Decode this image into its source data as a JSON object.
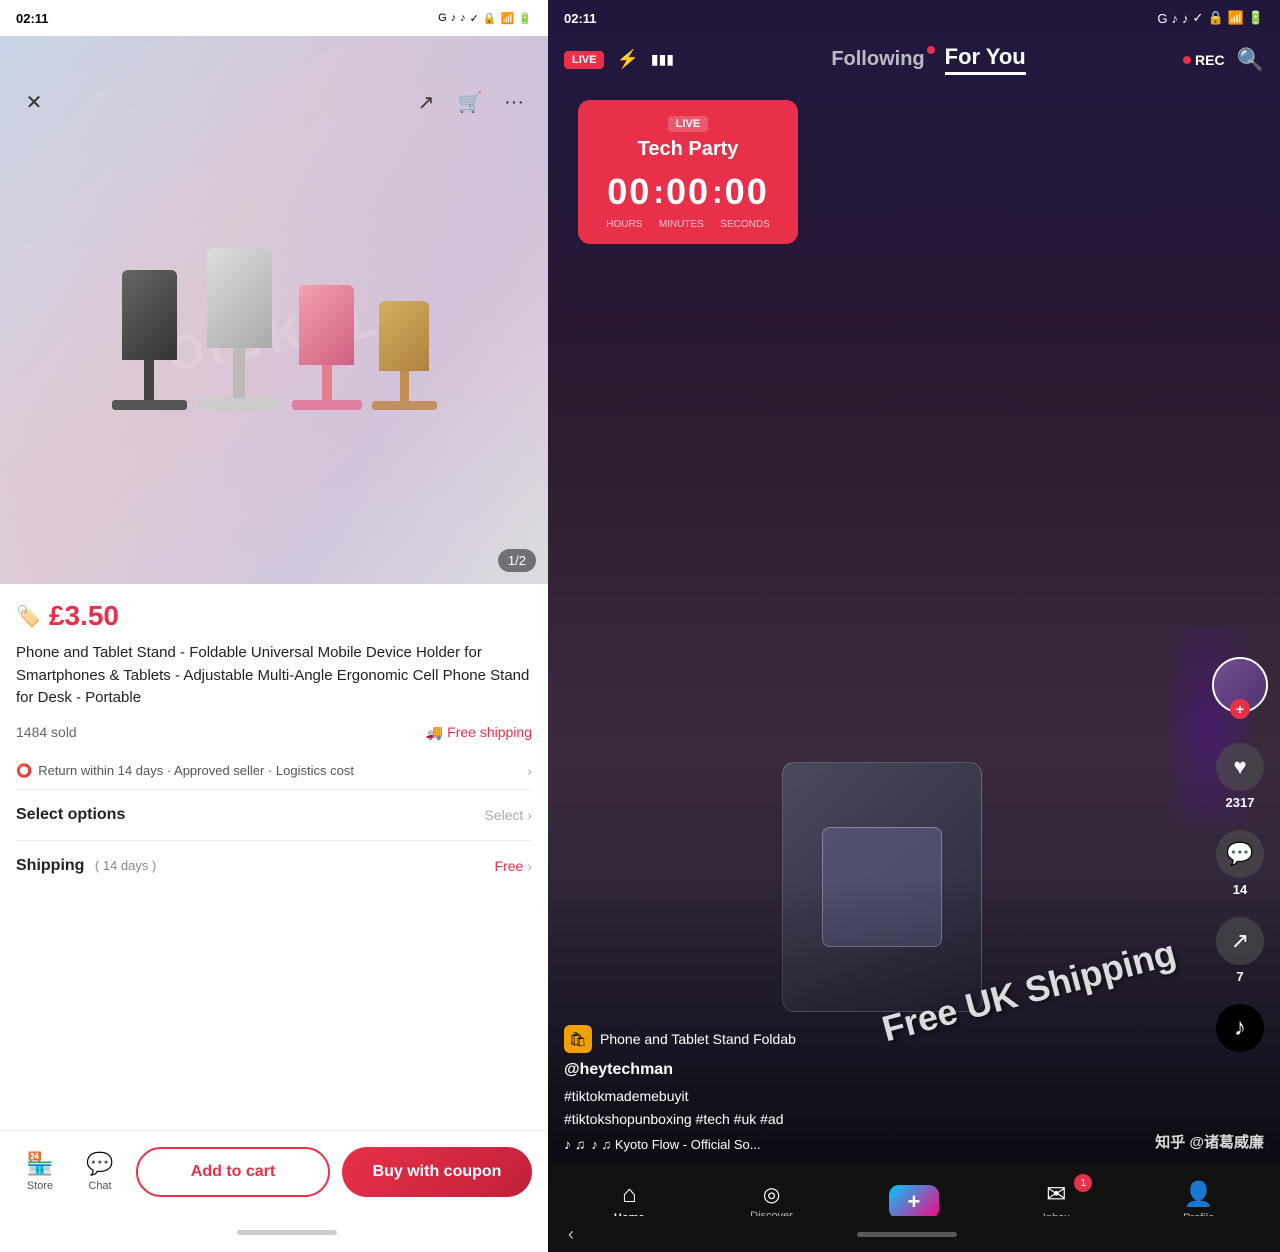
{
  "left": {
    "statusBar": {
      "time": "02:11",
      "icons": [
        "G",
        "TikTok",
        "TikTok",
        "✓",
        "•"
      ]
    },
    "topNav": {
      "close": "✕",
      "share": "↗",
      "cart": "🛒",
      "more": "···"
    },
    "product": {
      "price": "£3.50",
      "priceIcon": "🏷",
      "title": "Phone and Tablet Stand - Foldable Universal Mobile Device Holder for Smartphones & Tablets - Adjustable Multi-Angle Ergonomic Cell Phone Stand for Desk - Portable",
      "soldCount": "1484 sold",
      "freeShipping": "Free shipping",
      "returnInfo": "Return within 14 days · Approved seller · Logistics cost",
      "imageCounter": "1/2"
    },
    "selectOptions": {
      "label": "Select options",
      "value": "Select"
    },
    "shipping": {
      "label": "Shipping",
      "days": "( 14 days )",
      "value": "Free"
    },
    "bottomBar": {
      "store": "Store",
      "chat": "Chat",
      "addToCart": "Add to cart",
      "buyWithCoupon": "Buy with coupon"
    }
  },
  "right": {
    "statusBar": {
      "time": "02:11",
      "icons": [
        "G",
        "TikTok",
        "TikTok",
        "✓",
        "•"
      ]
    },
    "nav": {
      "live": "LIVE",
      "following": "Following",
      "forYou": "For You",
      "rec": "REC"
    },
    "liveCard": {
      "badge": "LIVE",
      "title": "Tech Party",
      "hours": "00",
      "minutes": "00",
      "seconds": "00",
      "hoursLabel": "HOURS",
      "minutesLabel": "MINUTES",
      "secondsLabel": "SECONDS"
    },
    "freeShippingText": "Free UK Shipping",
    "shopInfo": {
      "shopName": "Phone and Tablet Stand  Foldab",
      "username": "@heytechman",
      "hashtags": "#tiktokmademebuyit\n#tiktokshopunboxing #tech #uk #ad",
      "music": "♪ ♫  Kyoto Flow - Official So..."
    },
    "actions": {
      "likes": "2317",
      "comments": "14",
      "shares": "7"
    },
    "bottomNav": {
      "home": "Home",
      "discover": "Discover",
      "inbox": "Inbox",
      "profile": "Profile",
      "inboxBadge": "1"
    },
    "watermark": "知乎 @诸葛威廉"
  }
}
